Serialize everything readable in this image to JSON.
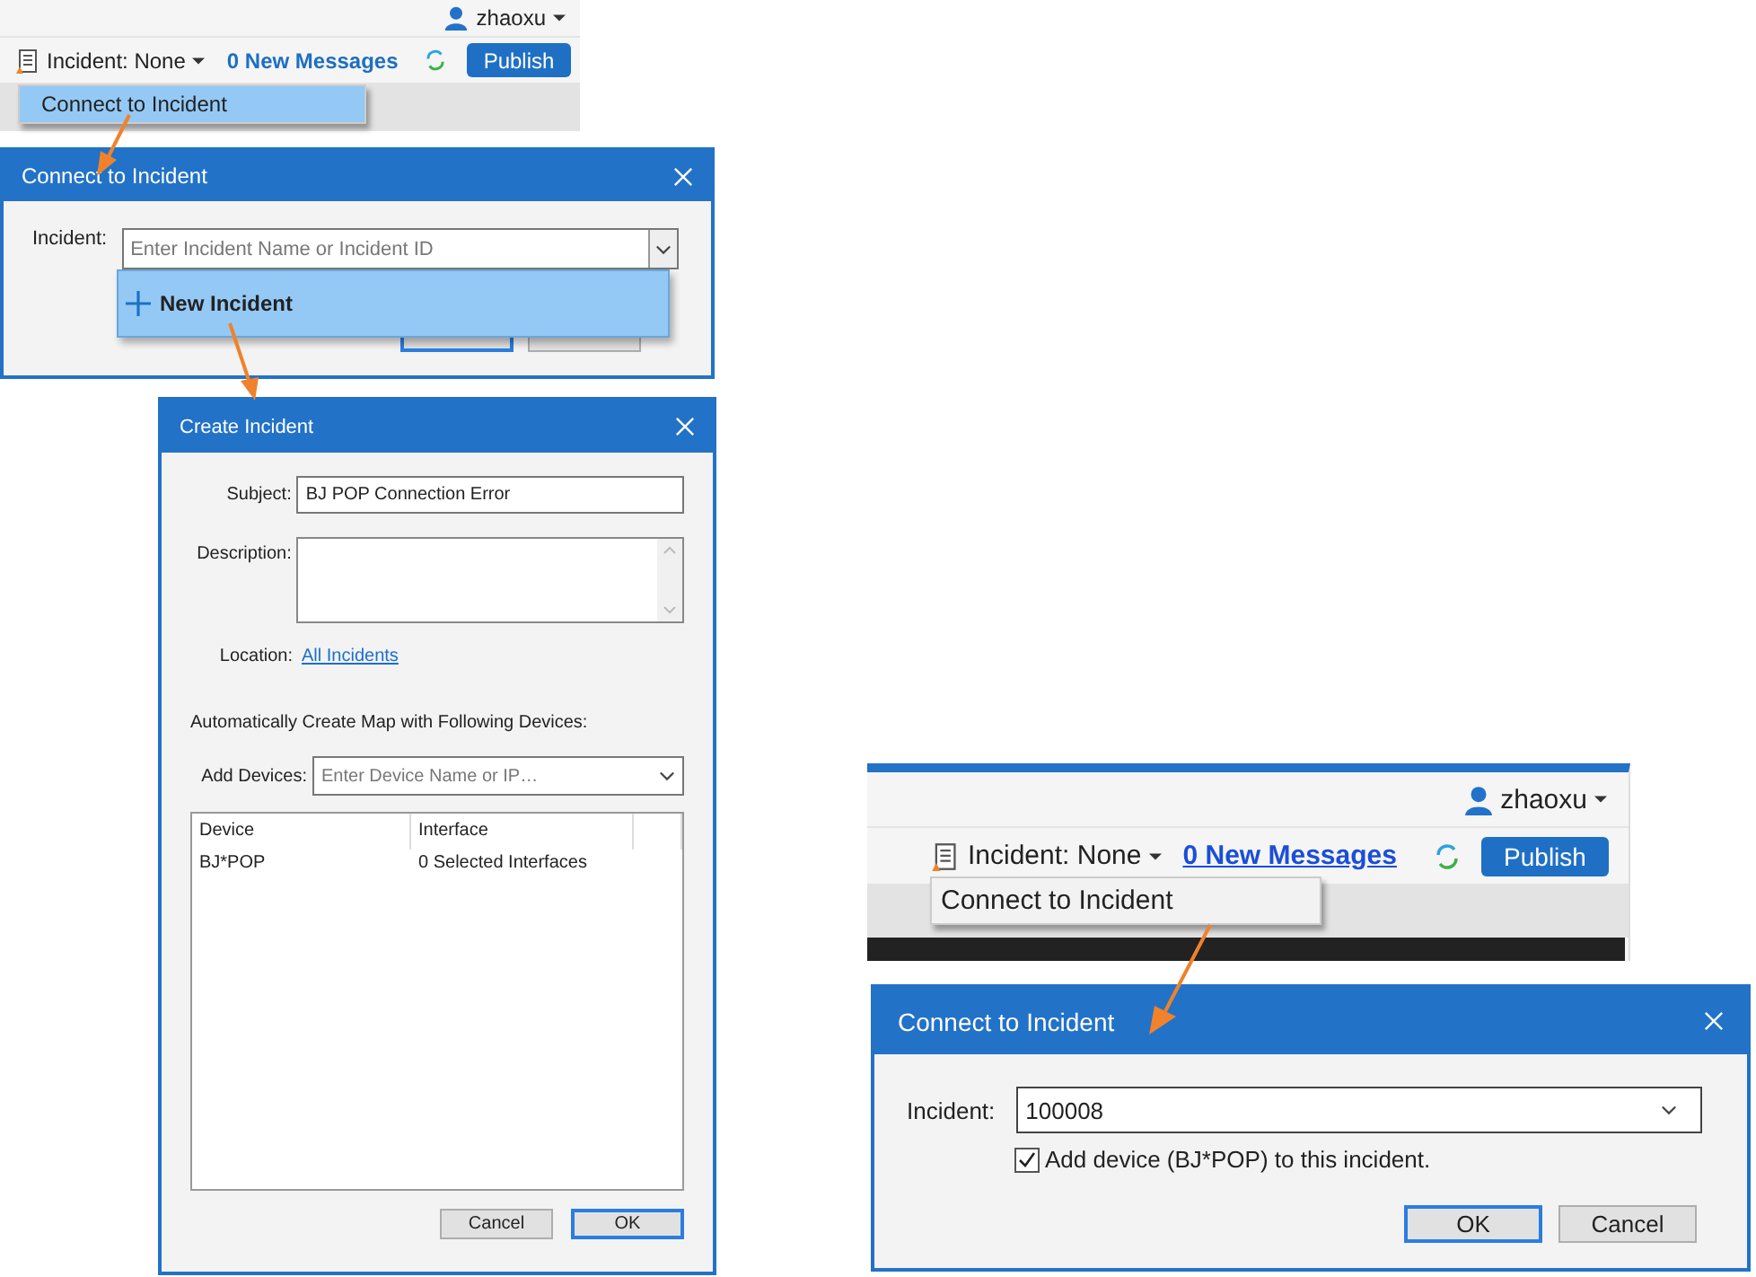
{
  "top_toolbar": {
    "user": "zhaoxu",
    "incident": "Incident: None",
    "messages": "0 New Messages",
    "publish": "Publish",
    "menu": [
      {
        "label": "Connect to Incident",
        "selected": true
      }
    ]
  },
  "connect_dialog_search": {
    "title": "Connect to Incident",
    "incident_label": "Incident:",
    "incident_field": {
      "placeholder": "Enter Incident Name or Incident ID"
    },
    "dropdown": [
      {
        "label": "New Incident",
        "selected": true
      }
    ],
    "buttons": [
      {
        "default": true
      },
      {
        "default": false
      }
    ]
  },
  "create_dialog": {
    "title": "Create Incident",
    "subject_label": "Subject:",
    "subject": "BJ POP Connection Error",
    "description_label": "Description:",
    "location_label": "Location:",
    "location_link": "All Incidents",
    "auto_map_label": "Automatically Create Map with Following Devices:",
    "add_devices_label": "Add Devices:",
    "add_devices_field": {
      "placeholder": "Enter Device Name or IP…"
    },
    "table": {
      "columns": [
        "Device",
        "Interface"
      ],
      "rows": [
        [
          "BJ*POP",
          "0 Selected Interfaces"
        ]
      ]
    },
    "buttons": [
      {
        "label": "Cancel",
        "default": false
      },
      {
        "label": "OK",
        "default": true
      }
    ]
  },
  "bottom_toolbar": {
    "user": "zhaoxu",
    "incident": "Incident: None",
    "messages": "0 New Messages",
    "publish": "Publish",
    "menu": [
      {
        "label": "Connect to Incident",
        "selected": false
      }
    ]
  },
  "connect_dialog_selected": {
    "title": "Connect to Incident",
    "incident_label": "Incident:",
    "incident_value": "100008",
    "add_device": {
      "label": "Add device (BJ*POP) to this incident.",
      "checked": true
    },
    "buttons": [
      {
        "label": "OK",
        "default": true
      },
      {
        "label": "Cancel",
        "default": false
      }
    ]
  }
}
